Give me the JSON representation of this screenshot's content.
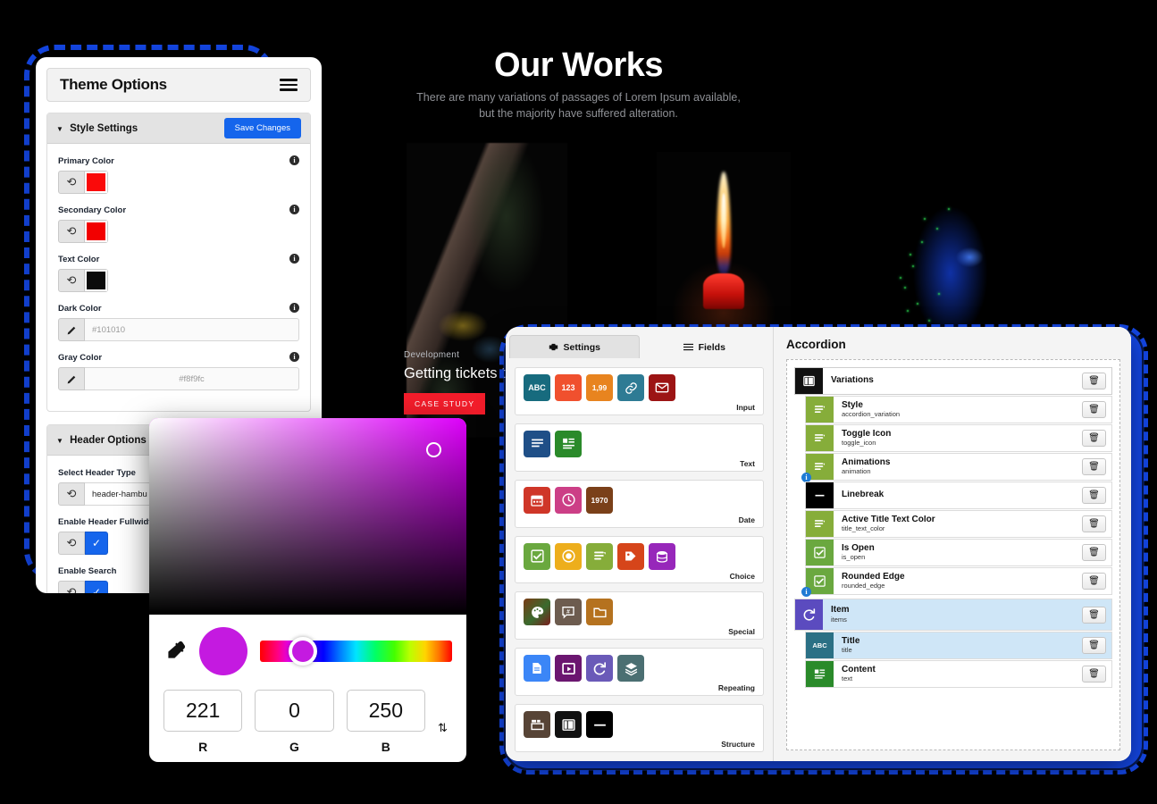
{
  "hero": {
    "title": "Our Works",
    "subtitle_line1": "There are many variations of passages of Lorem Ipsum available,",
    "subtitle_line2": "but the majority have suffered alteration.",
    "case": {
      "kicker": "Development",
      "headline": "Getting tickets to th",
      "button": "CASE STUDY"
    }
  },
  "theme_options": {
    "title": "Theme Options",
    "menu_icon": "hamburger-icon",
    "sections": [
      {
        "title": "Style Settings",
        "save_label": "Save Changes",
        "fields": [
          {
            "label": "Primary Color",
            "type": "swatch",
            "value": "#fa0a0a",
            "info": "i"
          },
          {
            "label": "Secondary Color",
            "type": "swatch",
            "value": "#f20000",
            "info": "i"
          },
          {
            "label": "Text Color",
            "type": "swatch",
            "value": "#0b0b0b",
            "info": "i"
          },
          {
            "label": "Dark Color",
            "type": "hex",
            "value": "#101010",
            "info": "i"
          },
          {
            "label": "Gray Color",
            "type": "hex",
            "value": "#f8f9fc",
            "info": "i"
          }
        ]
      },
      {
        "title": "Header Options",
        "fields": [
          {
            "label": "Select Header Type",
            "type": "select",
            "value": "header-hambu"
          },
          {
            "label": "Enable Header Fullwidth",
            "type": "checkbox",
            "value": "checked"
          },
          {
            "label": "Enable Search",
            "type": "checkbox",
            "value": "checked"
          }
        ]
      }
    ]
  },
  "color_picker": {
    "eyedropper_icon": "eyedropper-icon",
    "preview_color": "#c41ae0",
    "selected_color": "#dd00fa",
    "channels": [
      {
        "label": "R",
        "value": "221"
      },
      {
        "label": "G",
        "value": "0"
      },
      {
        "label": "B",
        "value": "250"
      }
    ],
    "stepper_icon": "updown-stepper-icon"
  },
  "builder": {
    "tabs": [
      {
        "label": "Settings",
        "icon": "gear-icon",
        "active": true
      },
      {
        "label": "Fields",
        "icon": "list-icon",
        "active": false
      }
    ],
    "field_groups": [
      {
        "label": "Input",
        "icons": [
          {
            "name": "text-field-icon",
            "glyph": "ABC",
            "color": "#176b7e"
          },
          {
            "name": "number-field-icon",
            "glyph": "123",
            "color": "#f0502e"
          },
          {
            "name": "decimal-field-icon",
            "glyph": "1,99",
            "color": "#e8841f"
          },
          {
            "name": "link-field-icon",
            "glyph": "link",
            "color": "#2e7b94"
          },
          {
            "name": "email-field-icon",
            "glyph": "mail",
            "color": "#9c1414"
          }
        ]
      },
      {
        "label": "Text",
        "icons": [
          {
            "name": "textarea-field-icon",
            "glyph": "lines",
            "color": "#1f4f87"
          },
          {
            "name": "wysiwyg-field-icon",
            "glyph": "wysiwyg",
            "color": "#2a8a2a"
          }
        ]
      },
      {
        "label": "Date",
        "icons": [
          {
            "name": "date-field-icon",
            "glyph": "calendar",
            "color": "#cf3628"
          },
          {
            "name": "time-field-icon",
            "glyph": "clock",
            "color": "#cc3f86"
          },
          {
            "name": "year-field-icon",
            "glyph": "1970",
            "color": "#7a4019"
          }
        ]
      },
      {
        "label": "Choice",
        "icons": [
          {
            "name": "checkbox-field-icon",
            "glyph": "check",
            "color": "#6aa83f"
          },
          {
            "name": "radio-field-icon",
            "glyph": "radio",
            "color": "#edae1c"
          },
          {
            "name": "select-field-icon",
            "glyph": "select",
            "color": "#86ad3a"
          },
          {
            "name": "tags-field-icon",
            "glyph": "tag",
            "color": "#d6451a"
          },
          {
            "name": "data-field-icon",
            "glyph": "db",
            "color": "#9727ba"
          }
        ]
      },
      {
        "label": "Special",
        "icons": [
          {
            "name": "color-field-icon",
            "glyph": "palette",
            "color": "#6b5a2e"
          },
          {
            "name": "icon-field-icon",
            "glyph": "hash",
            "color": "#6d5c4f"
          },
          {
            "name": "file-field-icon",
            "glyph": "folder",
            "color": "#b5721f"
          }
        ]
      },
      {
        "label": "Repeating",
        "icons": [
          {
            "name": "post-field-icon",
            "glyph": "doc",
            "color": "#3b86f7"
          },
          {
            "name": "video-field-icon",
            "glyph": "play",
            "color": "#6b1670"
          },
          {
            "name": "repeater-field-icon",
            "glyph": "repeat",
            "color": "#6a5ab8"
          },
          {
            "name": "layers-field-icon",
            "glyph": "layers",
            "color": "#4b6f72"
          }
        ]
      },
      {
        "label": "Structure",
        "icons": [
          {
            "name": "tabs-field-icon",
            "glyph": "tabs",
            "color": "#574436"
          },
          {
            "name": "columns-field-icon",
            "glyph": "columns",
            "color": "#111111"
          },
          {
            "name": "linebreak-field-icon",
            "glyph": "dash",
            "color": "#000000"
          }
        ]
      }
    ],
    "accordion": {
      "title": "Accordion",
      "rows": [
        {
          "label": "Variations",
          "key": "",
          "icon": "columns-icon",
          "color": "#111111",
          "indent": 0,
          "selected": false,
          "info": false,
          "delete": "trash-icon"
        },
        {
          "label": "Style",
          "key": "accordion_variation",
          "icon": "select-icon",
          "color": "#86ad3a",
          "indent": 1,
          "selected": false,
          "info": false,
          "delete": "trash-icon"
        },
        {
          "label": "Toggle Icon",
          "key": "toggle_icon",
          "icon": "select-icon",
          "color": "#86ad3a",
          "indent": 1,
          "selected": false,
          "info": false,
          "delete": "trash-icon"
        },
        {
          "label": "Animations",
          "key": "animation",
          "icon": "select-icon",
          "color": "#86ad3a",
          "indent": 1,
          "selected": false,
          "info": true,
          "delete": "trash-icon"
        },
        {
          "label": "Linebreak",
          "key": "",
          "icon": "dash-icon",
          "color": "#000000",
          "indent": 1,
          "selected": false,
          "info": false,
          "delete": "trash-icon"
        },
        {
          "label": "Active Title Text Color",
          "key": "title_text_color",
          "icon": "select-icon",
          "color": "#86ad3a",
          "indent": 1,
          "selected": false,
          "info": false,
          "delete": "trash-icon"
        },
        {
          "label": "Is Open",
          "key": "is_open",
          "icon": "check-icon",
          "color": "#6aa83f",
          "indent": 1,
          "selected": false,
          "info": false,
          "delete": "trash-icon"
        },
        {
          "label": "Rounded Edge",
          "key": "rounded_edge",
          "icon": "check-icon",
          "color": "#6aa83f",
          "indent": 1,
          "selected": false,
          "info": true,
          "delete": "trash-icon"
        },
        {
          "label": "Item",
          "key": "items",
          "icon": "repeat-icon",
          "color": "#5b4bbf",
          "indent": 0,
          "selected": true,
          "info": false,
          "delete": "trash-icon"
        },
        {
          "label": "Title",
          "key": "title",
          "icon": "abc-icon",
          "color": "#2b7085",
          "indent": 1,
          "selected": true,
          "info": false,
          "delete": "trash-icon"
        },
        {
          "label": "Content",
          "key": "text",
          "icon": "wysiwyg-icon",
          "color": "#2a8a2a",
          "indent": 1,
          "selected": false,
          "info": false,
          "delete": "trash-icon"
        }
      ]
    }
  },
  "colors": {
    "accent_blue": "#1447e6",
    "save_blue": "#1565ec",
    "case_red": "#f41d2b",
    "picker_purple": "#dd00fa"
  }
}
